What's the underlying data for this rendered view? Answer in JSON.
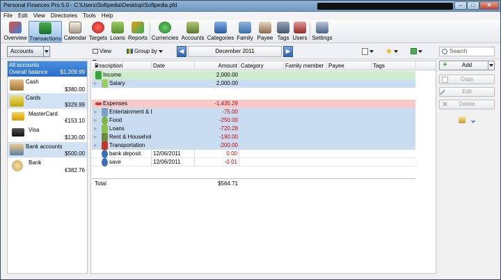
{
  "window": {
    "title": "Personal Finances Pro 5.0 - C:\\Users\\Softpedia\\Desktop\\Softpedia.pfd",
    "min": "–",
    "max": "□",
    "close": "✕"
  },
  "menu": [
    "File",
    "Edit",
    "View",
    "Directories",
    "Tools",
    "Help"
  ],
  "toolbar": [
    {
      "label": "Overview",
      "icon": "overview-icon",
      "color": "#c0392b"
    },
    {
      "label": "Transactions",
      "icon": "transactions-icon",
      "color": "#2e8b57"
    },
    {
      "label": "Calendar",
      "icon": "calendar-icon",
      "color": "#8a7a6a"
    },
    {
      "label": "Targets",
      "icon": "targets-icon",
      "color": "#d9342b"
    },
    {
      "label": "Loans",
      "icon": "loans-icon",
      "color": "#6aa84f"
    },
    {
      "label": "Reports",
      "icon": "reports-icon",
      "color": "#e07b24"
    },
    {
      "label": "Currencies",
      "icon": "currencies-icon",
      "color": "#2f9e44"
    },
    {
      "label": "Accounts",
      "icon": "accounts-icon",
      "color": "#6b8e23"
    },
    {
      "label": "Categories",
      "icon": "categories-icon",
      "color": "#3b6fb6"
    },
    {
      "label": "Family",
      "icon": "family-icon",
      "color": "#4f7fb9"
    },
    {
      "label": "Payee",
      "icon": "payee-icon",
      "color": "#7a5c3e"
    },
    {
      "label": "Tags",
      "icon": "tags-icon",
      "color": "#4b5d73"
    },
    {
      "label": "Users",
      "icon": "users-icon",
      "color": "#a33a3a"
    },
    {
      "label": "Settings",
      "icon": "settings-icon",
      "color": "#516b8f"
    }
  ],
  "subbar": {
    "accounts": "Accounts",
    "view": "View",
    "group_by": "Group by",
    "month": "December 2011",
    "prev": "◀",
    "next": "▶",
    "search_placeholder": "Search"
  },
  "sidebar": {
    "all": {
      "label": "All accounts",
      "sub": "Overall balance",
      "amount": "$1,209.99"
    },
    "items": [
      {
        "name": "Cash",
        "amount": "$380.00",
        "icon": "cash-icon"
      },
      {
        "name": "Cards",
        "amount": "$329.99",
        "icon": "cards-icon"
      },
      {
        "name": "MasterCard",
        "amount": "€153.10",
        "icon": "mastercard-icon"
      },
      {
        "name": "Visa",
        "amount": "$130.00",
        "icon": "visa-icon"
      },
      {
        "name": "Bank accounts",
        "amount": "$500.00",
        "icon": "bank-accounts-icon"
      },
      {
        "name": "Bank",
        "amount": "€382.76",
        "icon": "bank-icon"
      }
    ]
  },
  "columns": [
    "Description",
    "Date",
    "Amount",
    "Category",
    "Family member",
    "Payee",
    "Tags"
  ],
  "rows": [
    {
      "desc": "Income",
      "date": "",
      "amount": "2,000.00"
    },
    {
      "desc": "Salary",
      "date": "",
      "amount": "2,000.00"
    },
    {
      "desc": "Expenses",
      "date": "",
      "amount": "-1,435.29"
    },
    {
      "desc": "Entertainment & R",
      "date": "",
      "amount": "-75.00"
    },
    {
      "desc": "Food",
      "date": "",
      "amount": "-250.00"
    },
    {
      "desc": "Loans",
      "date": "",
      "amount": "-720.28"
    },
    {
      "desc": "Rent & Household",
      "date": "",
      "amount": "-190.00"
    },
    {
      "desc": "Transportation",
      "date": "",
      "amount": "-200.00"
    },
    {
      "desc": "bank deposit",
      "date": "12/06/2011",
      "amount": "0.00"
    },
    {
      "desc": "save",
      "date": "12/06/2011",
      "amount": "-0.01"
    }
  ],
  "total": {
    "label": "Total",
    "amount": "$564.71"
  },
  "actions": {
    "add": "Add",
    "copy": "Copy",
    "edit": "Edit",
    "delete": "Delete"
  }
}
